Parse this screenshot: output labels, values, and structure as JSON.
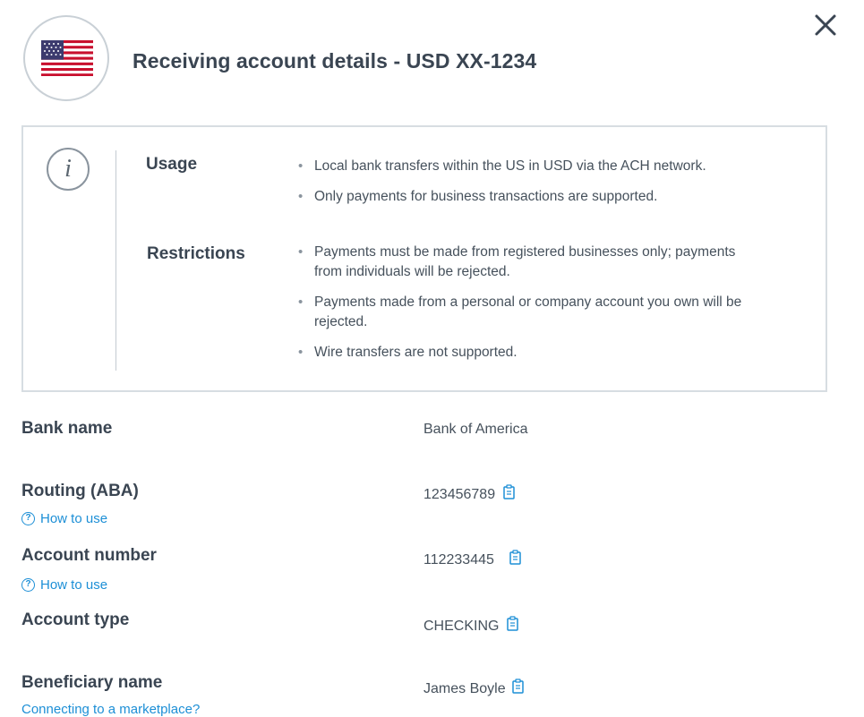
{
  "header": {
    "title": "Receiving account details - USD XX-1234",
    "flag_icon": "us-flag-icon",
    "close_icon": "close-icon"
  },
  "info": {
    "icon": "info-icon",
    "usage_label": "Usage",
    "usage_items": [
      "Local bank transfers within the US in USD via the ACH network.",
      "Only payments for business transactions are supported."
    ],
    "restrictions_label": "Restrictions",
    "restriction_items": [
      "Payments must be made from registered businesses only; payments from individuals will be rejected.",
      "Payments made from a personal or company account you own will be rejected.",
      "Wire transfers are not supported."
    ]
  },
  "details": {
    "bank_name_label": "Bank name",
    "bank_name_value": "Bank of America",
    "routing_label": "Routing (ABA)",
    "routing_value": "123456789",
    "routing_help": "How to use",
    "account_number_label": "Account number",
    "account_number_value": "112233445",
    "account_number_help": "How to use",
    "account_type_label": "Account type",
    "account_type_value": "CHECKING",
    "beneficiary_label": "Beneficiary name",
    "beneficiary_value": "James Boyle",
    "beneficiary_link": "Connecting to a marketplace?"
  },
  "colors": {
    "link": "#1d8fd6",
    "text": "#3a4552",
    "border": "#d7dde2"
  }
}
